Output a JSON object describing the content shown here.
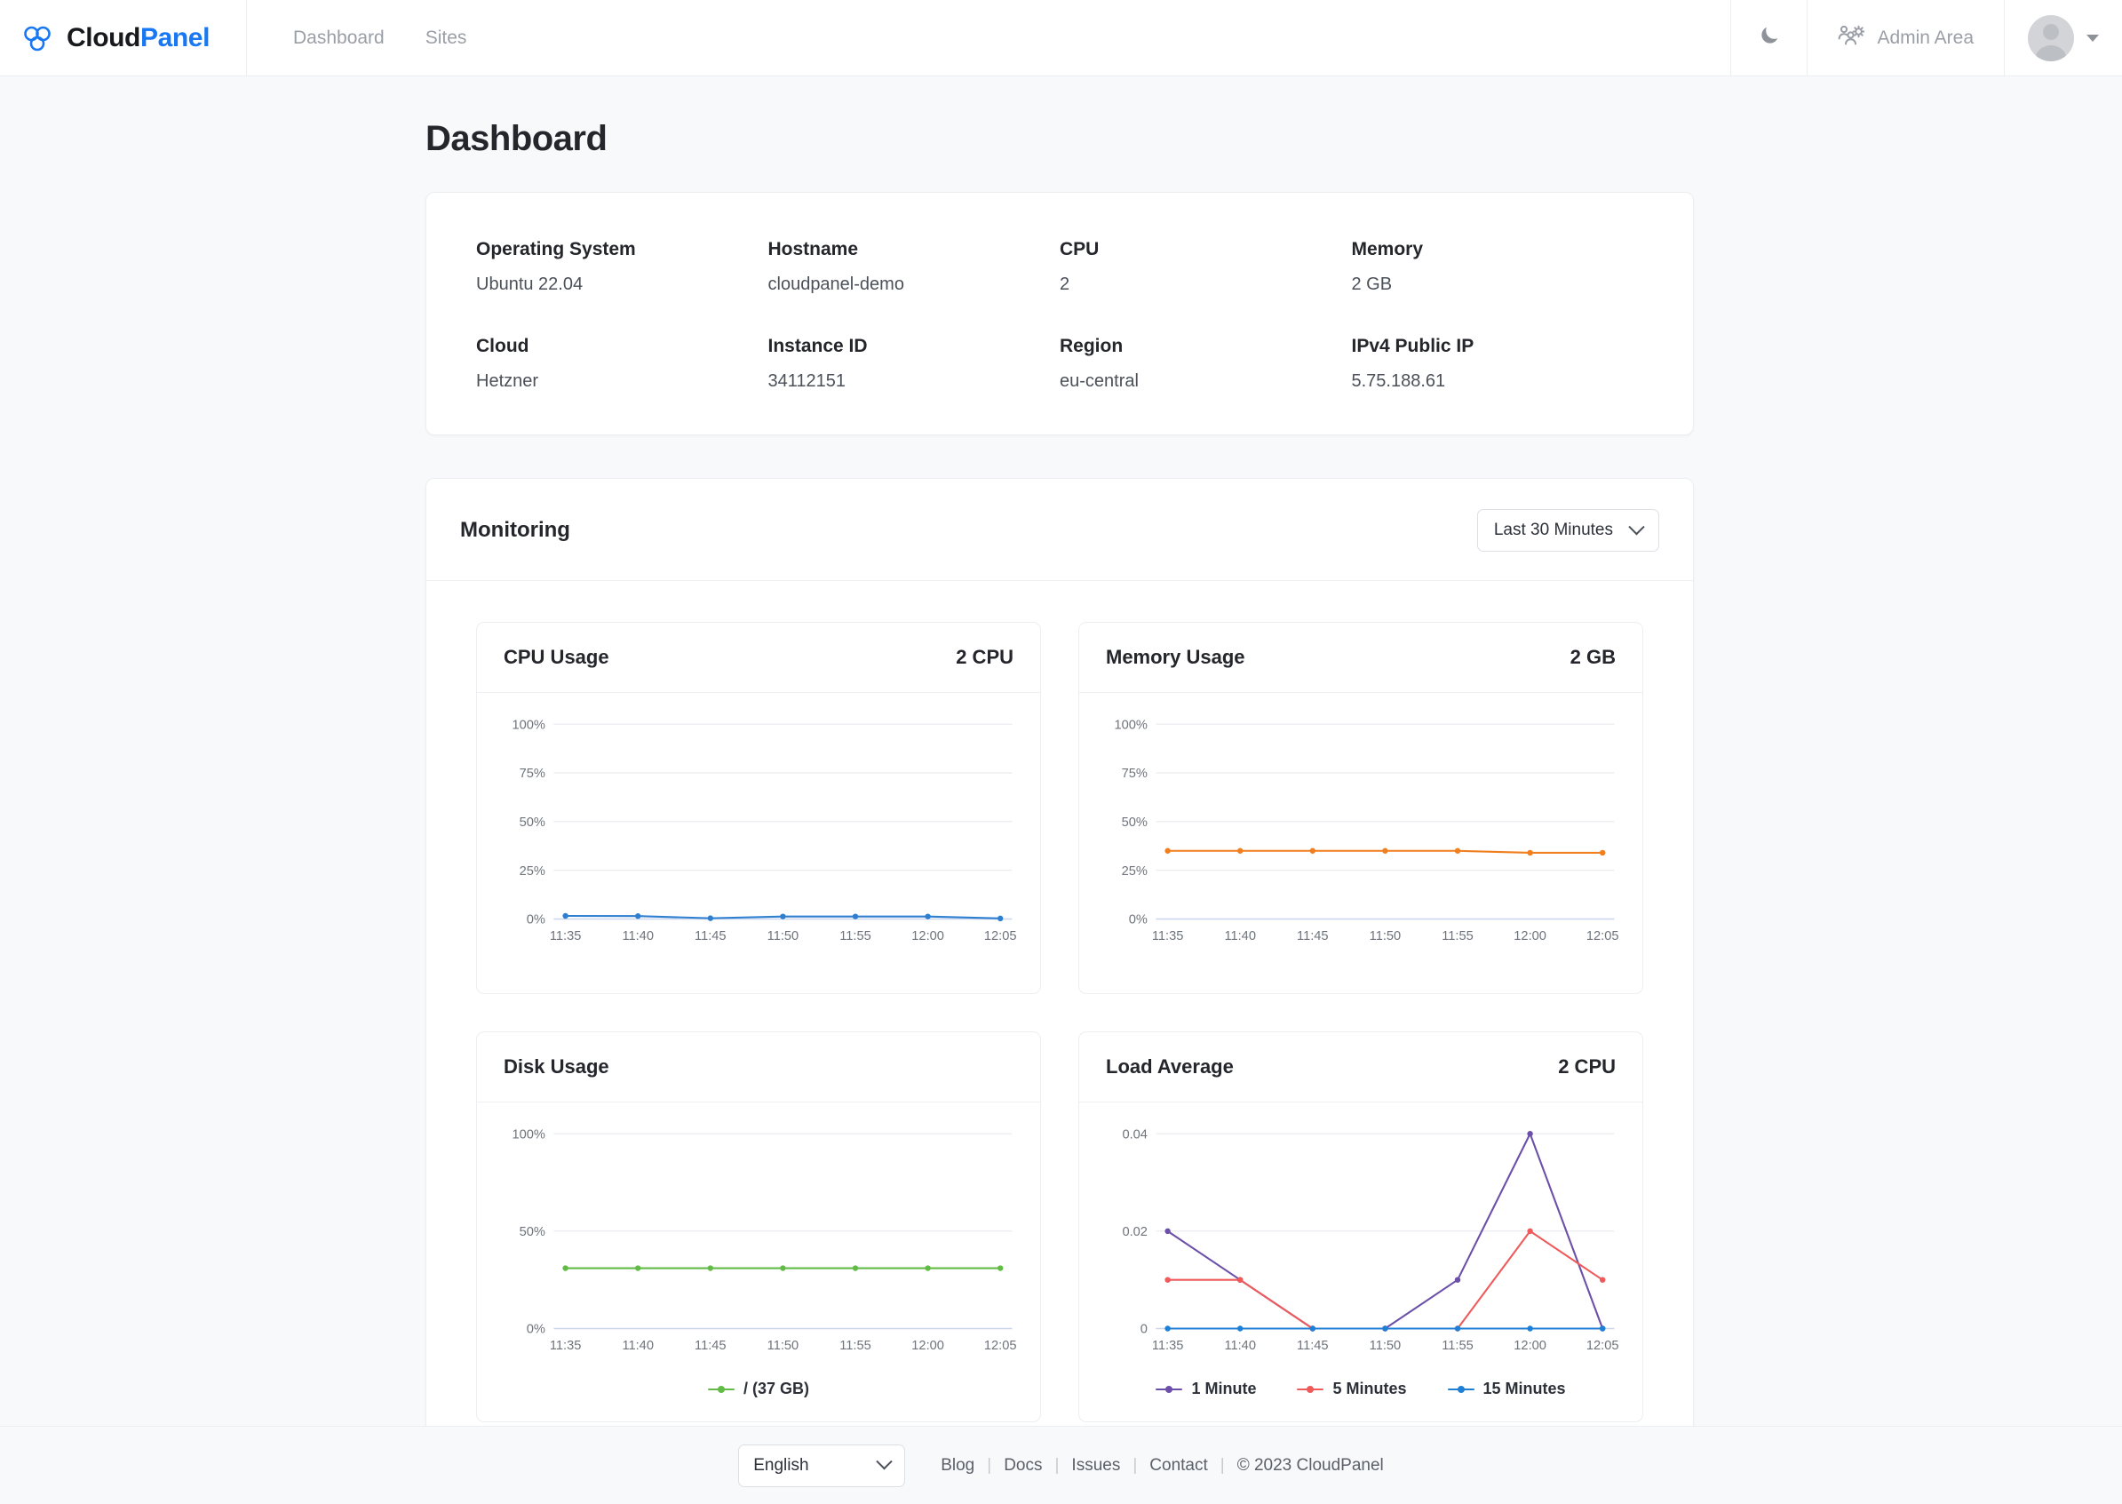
{
  "header": {
    "brand": {
      "part1": "Cloud",
      "part2": "Panel",
      "logo_icon": "cloud-logo-icon"
    },
    "nav": [
      {
        "label": "Dashboard",
        "name": "nav-dashboard"
      },
      {
        "label": "Sites",
        "name": "nav-sites"
      }
    ],
    "dark_mode_icon": "moon-icon",
    "admin_area_label": "Admin Area",
    "admin_area_icon": "users-gear-icon",
    "user_menu_icon": "chevron-down-icon"
  },
  "page": {
    "title": "Dashboard"
  },
  "server_info": [
    {
      "label": "Operating System",
      "value": "Ubuntu 22.04"
    },
    {
      "label": "Hostname",
      "value": "cloudpanel-demo"
    },
    {
      "label": "CPU",
      "value": "2"
    },
    {
      "label": "Memory",
      "value": "2 GB"
    },
    {
      "label": "Cloud",
      "value": "Hetzner"
    },
    {
      "label": "Instance ID",
      "value": "34112151"
    },
    {
      "label": "Region",
      "value": "eu-central"
    },
    {
      "label": "IPv4 Public IP",
      "value": "5.75.188.61"
    }
  ],
  "monitoring": {
    "title": "Monitoring",
    "range_selected": "Last 30 Minutes"
  },
  "colors": {
    "brand_blue": "#1877f2",
    "cpu_line": "#2f7fd1",
    "memory_line": "#f07f20",
    "disk_line": "#62bb46",
    "load_1min": "#6b4fa8",
    "load_5min": "#ef5a5a",
    "load_15min": "#1f7fd4",
    "grid": "#e8eaee",
    "axis_baseline": "#c9d6ee"
  },
  "chart_data": [
    {
      "type": "line",
      "title": "CPU Usage",
      "metric": "2 CPU",
      "xlabel": "",
      "ylabel": "",
      "ylim": [
        0,
        100
      ],
      "yticks": [
        0,
        25,
        50,
        75,
        100
      ],
      "ytick_labels": [
        "0%",
        "25%",
        "50%",
        "75%",
        "100%"
      ],
      "x": [
        "11:35",
        "11:40",
        "11:45",
        "11:50",
        "11:55",
        "12:00",
        "12:05"
      ],
      "grid": true,
      "legend": null,
      "series": [
        {
          "name": "CPU Usage",
          "color": "#2f7fd1",
          "values": [
            1.6,
            1.5,
            0.4,
            1.3,
            1.3,
            1.3,
            0.3
          ]
        }
      ]
    },
    {
      "type": "line",
      "title": "Memory Usage",
      "metric": "2 GB",
      "xlabel": "",
      "ylabel": "",
      "ylim": [
        0,
        100
      ],
      "yticks": [
        0,
        25,
        50,
        75,
        100
      ],
      "ytick_labels": [
        "0%",
        "25%",
        "50%",
        "75%",
        "100%"
      ],
      "x": [
        "11:35",
        "11:40",
        "11:45",
        "11:50",
        "11:55",
        "12:00",
        "12:05"
      ],
      "grid": true,
      "legend": null,
      "series": [
        {
          "name": "Memory Usage",
          "color": "#f07f20",
          "values": [
            35,
            35,
            35,
            35,
            35,
            34,
            34
          ]
        }
      ]
    },
    {
      "type": "line",
      "title": "Disk Usage",
      "metric": "",
      "xlabel": "",
      "ylabel": "",
      "ylim": [
        0,
        100
      ],
      "yticks": [
        0,
        50,
        100
      ],
      "ytick_labels": [
        "0%",
        "50%",
        "100%"
      ],
      "x": [
        "11:35",
        "11:40",
        "11:45",
        "11:50",
        "11:55",
        "12:00",
        "12:05"
      ],
      "grid": true,
      "legend": [
        "/ (37 GB)"
      ],
      "series": [
        {
          "name": "/ (37 GB)",
          "color": "#62bb46",
          "values": [
            31,
            31,
            31,
            31,
            31,
            31,
            31
          ]
        }
      ]
    },
    {
      "type": "line",
      "title": "Load Average",
      "metric": "2 CPU",
      "xlabel": "",
      "ylabel": "",
      "ylim": [
        0,
        0.04
      ],
      "yticks": [
        0,
        0.02,
        0.04
      ],
      "ytick_labels": [
        "0",
        "0.02",
        "0.04"
      ],
      "x": [
        "11:35",
        "11:40",
        "11:45",
        "11:50",
        "11:55",
        "12:00",
        "12:05"
      ],
      "grid": true,
      "legend": [
        "1 Minute",
        "5 Minutes",
        "15 Minutes"
      ],
      "series": [
        {
          "name": "1 Minute",
          "color": "#6b4fa8",
          "values": [
            0.02,
            0.01,
            0,
            0,
            0.01,
            0.04,
            0
          ]
        },
        {
          "name": "5 Minutes",
          "color": "#ef5a5a",
          "values": [
            0.01,
            0.01,
            0,
            0,
            0,
            0.02,
            0.01
          ]
        },
        {
          "name": "15 Minutes",
          "color": "#1f7fd4",
          "values": [
            0,
            0,
            0,
            0,
            0,
            0,
            0
          ]
        }
      ]
    }
  ],
  "footer": {
    "language_selected": "English",
    "links": [
      {
        "label": "Blog"
      },
      {
        "label": "Docs"
      },
      {
        "label": "Issues"
      },
      {
        "label": "Contact"
      }
    ],
    "separator": "|",
    "copyright": "© 2023  CloudPanel"
  }
}
